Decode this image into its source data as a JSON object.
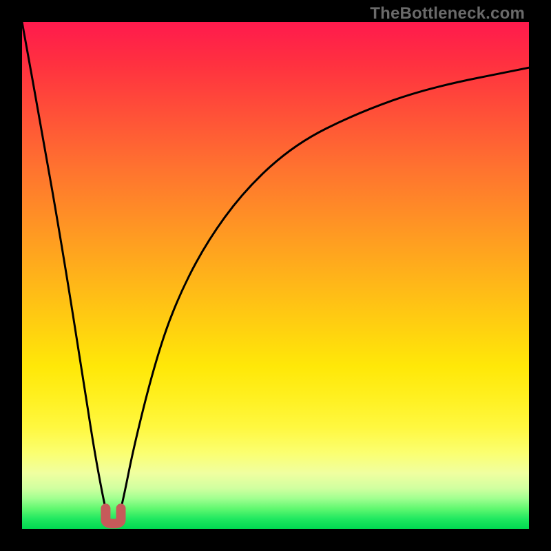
{
  "watermark": "TheBottleneck.com",
  "colors": {
    "frame": "#000000",
    "curve": "#000000",
    "tip": "#c65a5a",
    "gradient_top": "#ff1a4d",
    "gradient_bottom": "#00d850"
  },
  "chart_data": {
    "type": "line",
    "title": "",
    "xlabel": "",
    "ylabel": "",
    "xlim": [
      0,
      100
    ],
    "ylim": [
      0,
      100
    ],
    "notes": "Axes unlabeled; y inverted visually (high value = red at top). Curve dips to ~0 near x≈17–19 then rises toward ~90 at x=100. Values estimated from pixel positions.",
    "series": [
      {
        "name": "bottleneck-curve",
        "x": [
          0,
          4,
          8,
          12,
          14,
          16,
          17,
          18,
          19,
          20,
          22,
          26,
          30,
          36,
          44,
          54,
          66,
          80,
          100
        ],
        "y": [
          100,
          78,
          55,
          30,
          17,
          6,
          2,
          0.5,
          2,
          6,
          16,
          32,
          44,
          56,
          67,
          76,
          82,
          87,
          91
        ]
      }
    ],
    "highlight": {
      "name": "minimum-tip",
      "x_range": [
        16.5,
        19.5
      ],
      "y": 0.5
    }
  }
}
